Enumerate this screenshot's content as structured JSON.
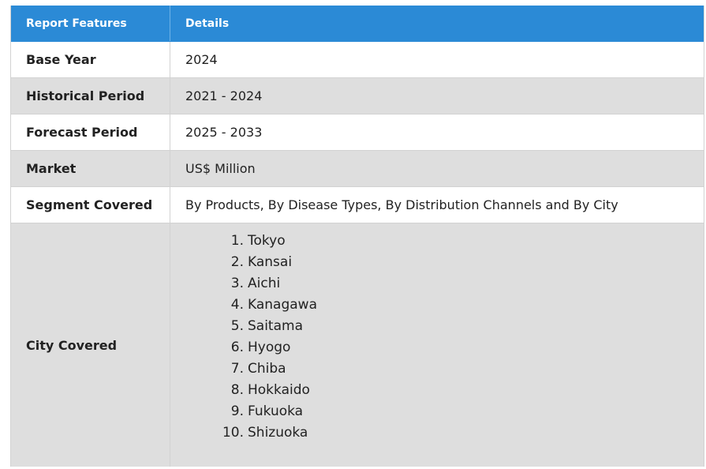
{
  "header": {
    "col1": "Report Features",
    "col2": "Details"
  },
  "rows": [
    {
      "label": "Base Year",
      "value": "2024"
    },
    {
      "label": "Historical Period",
      "value": "2021 - 2024"
    },
    {
      "label": "Forecast Period",
      "value": "2025 - 2033"
    },
    {
      "label": "Market",
      "value": "US$ Million"
    },
    {
      "label": "Segment Covered",
      "value": "By Products, By Disease Types, By Distribution Channels and By City"
    }
  ],
  "city_row": {
    "label": "City Covered",
    "cities": [
      {
        "num": "1.",
        "name": "Tokyo"
      },
      {
        "num": "2.",
        "name": "Kansai"
      },
      {
        "num": "3.",
        "name": "Aichi"
      },
      {
        "num": "4.",
        "name": "Kanagawa"
      },
      {
        "num": "5.",
        "name": "Saitama"
      },
      {
        "num": "6.",
        "name": "Hyogo"
      },
      {
        "num": "7.",
        "name": "Chiba"
      },
      {
        "num": "8.",
        "name": "Hokkaido"
      },
      {
        "num": "9.",
        "name": "Fukuoka"
      },
      {
        "num": "10.",
        "name": "Shizuoka"
      }
    ]
  },
  "colors": {
    "header_bg": "#2b8ad6",
    "row_gray": "#dedede",
    "row_white": "#ffffff"
  }
}
